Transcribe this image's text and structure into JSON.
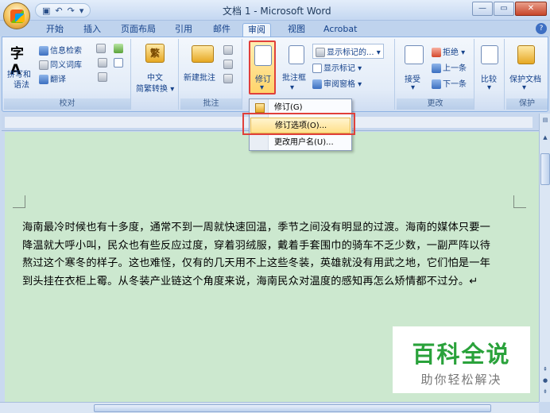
{
  "window": {
    "title": "文档 1 - Microsoft Word"
  },
  "tabs": [
    {
      "label": "开始"
    },
    {
      "label": "插入"
    },
    {
      "label": "页面布局"
    },
    {
      "label": "引用"
    },
    {
      "label": "邮件"
    },
    {
      "label": "审阅"
    },
    {
      "label": "视图"
    },
    {
      "label": "Acrobat"
    }
  ],
  "ribbon": {
    "proofing": {
      "spelling_l1": "拼写和",
      "spelling_l2": "语法",
      "research": "信息检索",
      "thesaurus": "同义词库",
      "translate": "翻译",
      "label": "校对"
    },
    "chinese": {
      "conv_l1": "中文",
      "conv_l2": "简繁转换",
      "icon_char": "繁"
    },
    "comments": {
      "new_comment": "新建批注",
      "label": "批注"
    },
    "tracking": {
      "track_changes": "修订",
      "balloons": "批注框",
      "markup_display": "显示标记的...",
      "show_markup": "显示标记",
      "review_pane": "审阅窗格"
    },
    "changes": {
      "accept": "接受",
      "reject": "拒绝",
      "previous": "上一条",
      "next": "下一条",
      "label": "更改"
    },
    "compare": {
      "label": "比较"
    },
    "protect": {
      "protect_doc_l1": "保护文档",
      "label": "保护"
    }
  },
  "dropdown": {
    "items": [
      {
        "label": "修订(G)"
      },
      {
        "label": "修订选项(O)..."
      },
      {
        "label": "更改用户名(U)..."
      }
    ]
  },
  "document": {
    "lines": [
      "海南最冷时候也有十多度，通常不到一周就快速回温，季节之间没有明显的过渡。海南的媒体只要一",
      "降温就大呼小叫，民众也有些反应过度，穿着羽绒服，戴着手套围巾的骑车不乏少数，一副严阵以待",
      "熬过这个寒冬的样子。这也难怪，仅有的几天用不上这些冬装，英雄就没有用武之地，它们怕是一年",
      "到头挂在衣柜上霉。从冬装产业链这个角度来说，海南民众对温度的感知再怎么矫情都不过分。↵"
    ]
  },
  "watermark": {
    "title": "百科全说",
    "subtitle": "助你轻松解决"
  }
}
